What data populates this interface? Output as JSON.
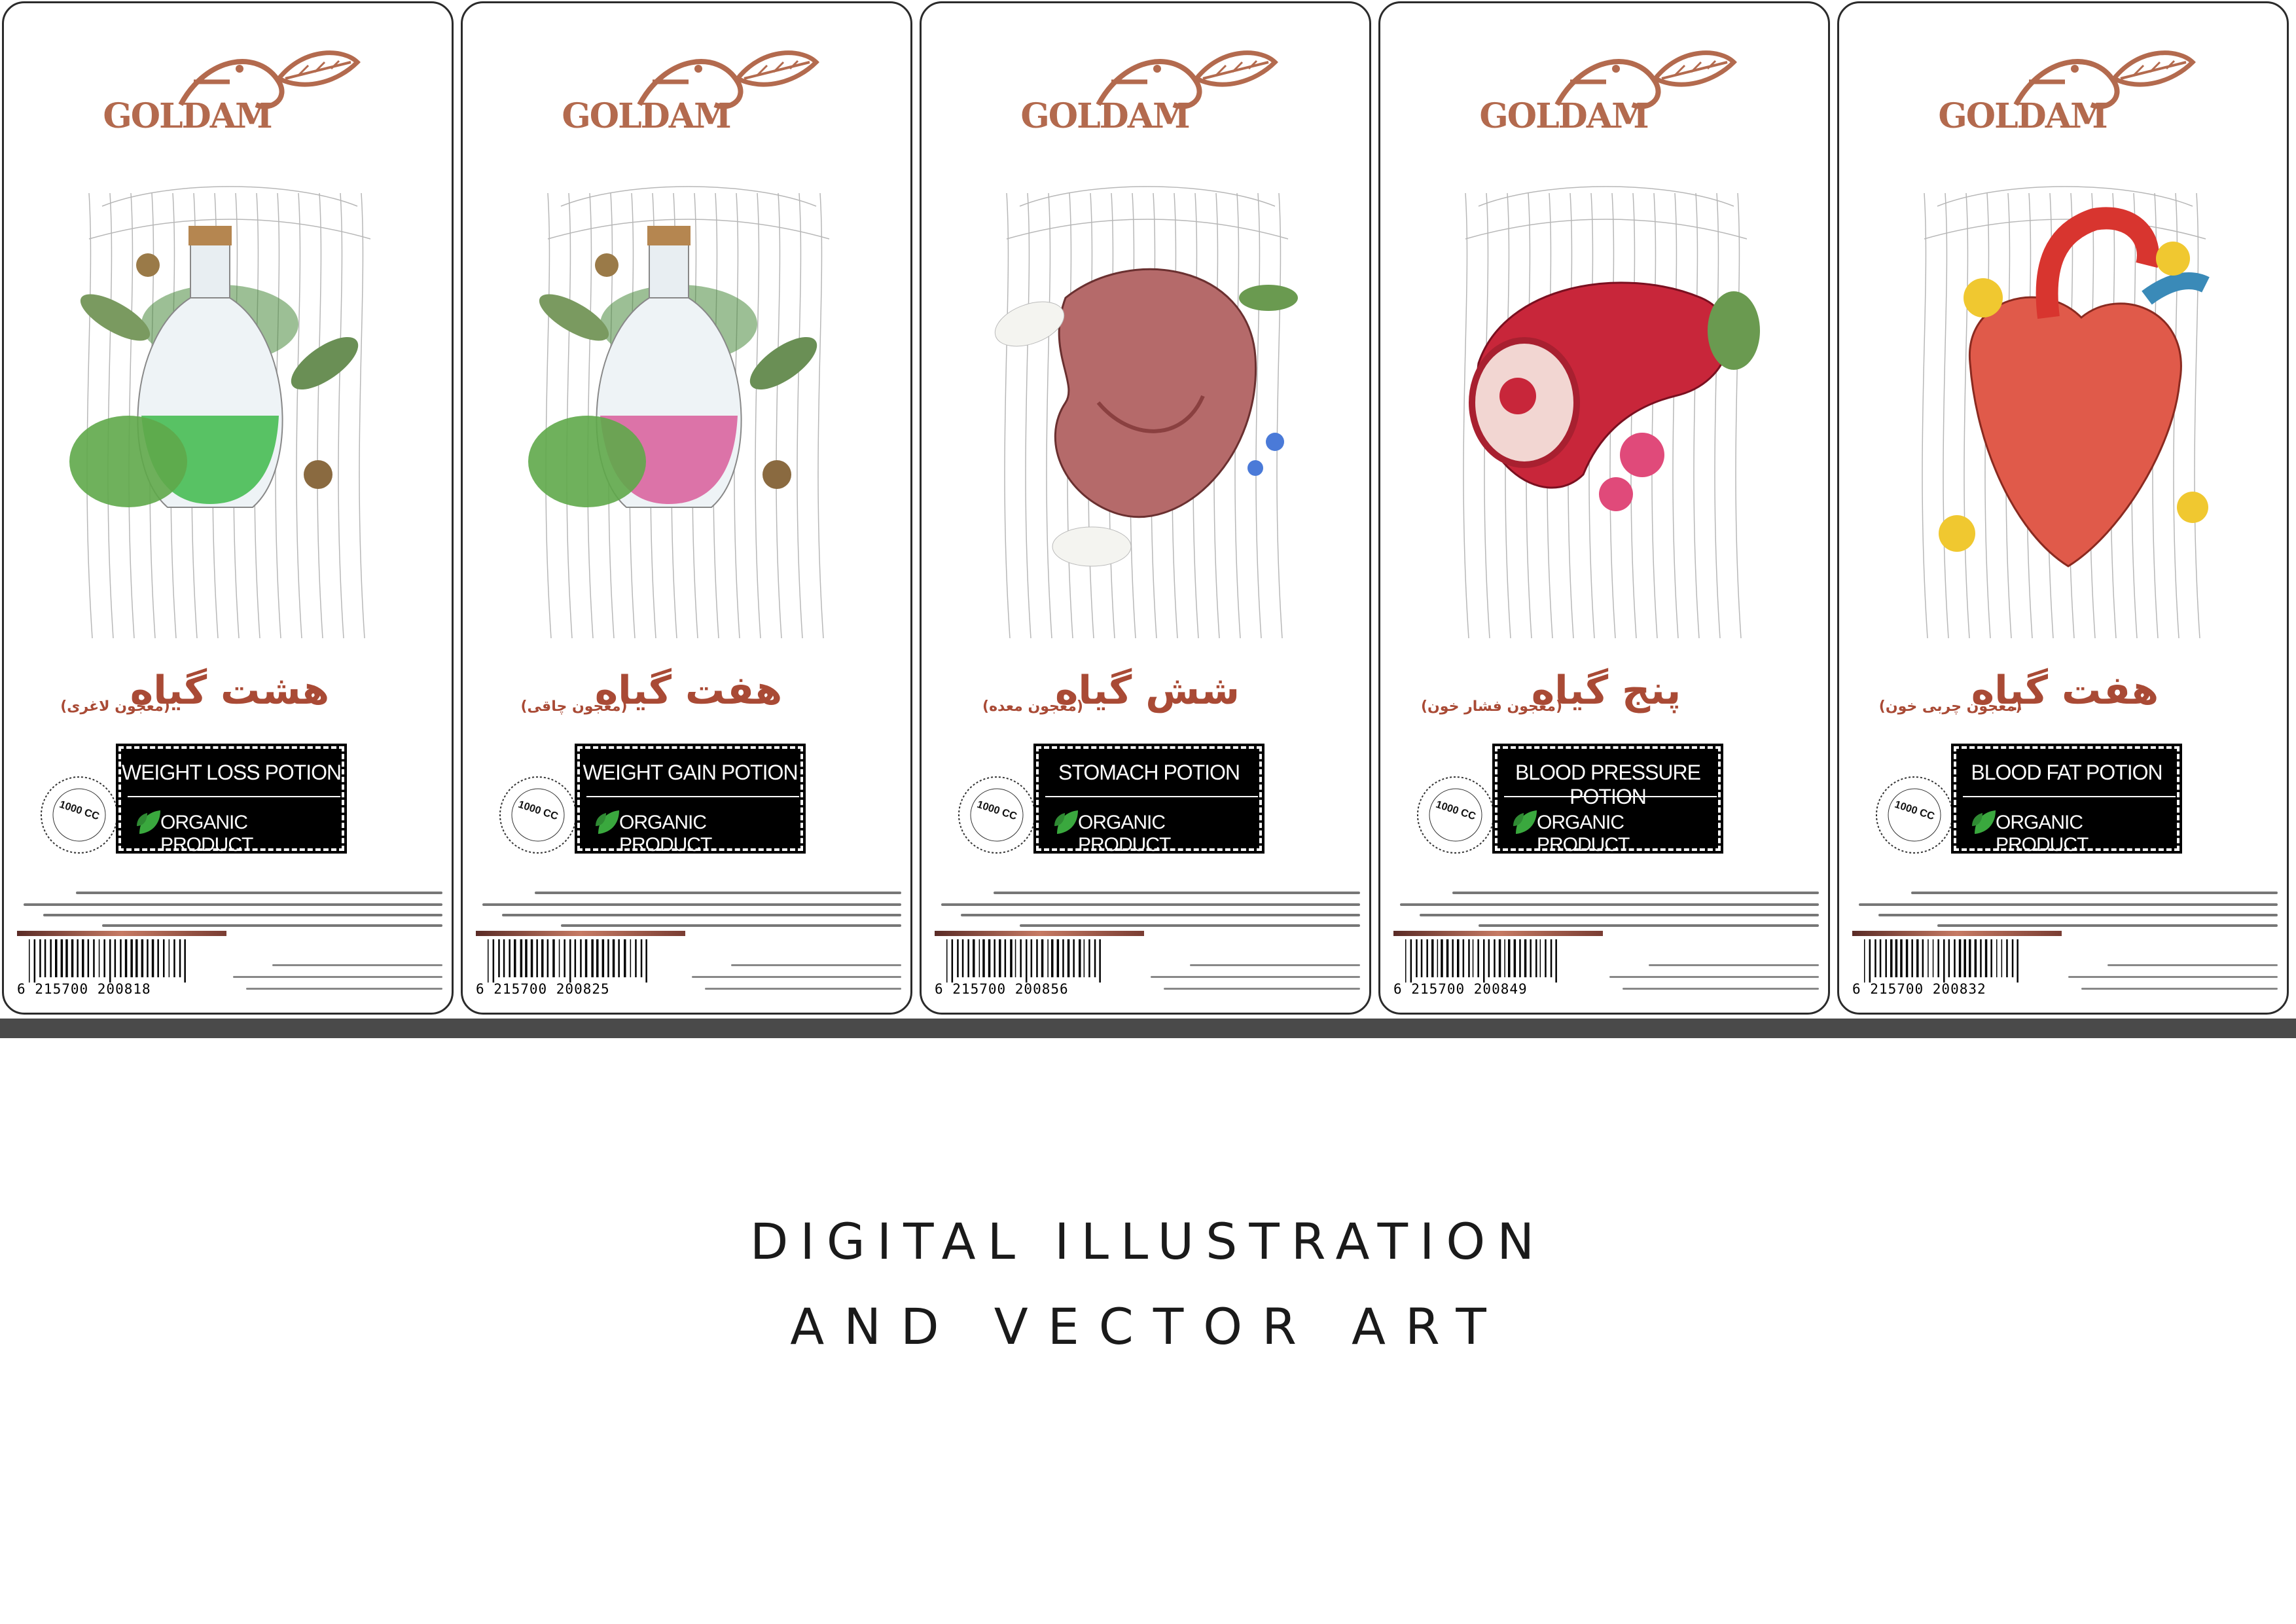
{
  "brand": {
    "logo_text": "GOLDAM",
    "accent_color": "#b36a4e",
    "title_color": "#a94a35"
  },
  "labels": [
    {
      "title_fa": "هشت گیاه",
      "subtitle_fa": "(معجون لاغری)",
      "potion_name": "WEIGHT LOSS POTION",
      "organic": "ORGANIC PRODUCT",
      "volume": "1000 CC",
      "barcode": "6 215700 200818",
      "illustration_icon": "potion-bottle-green-icon",
      "art_color": "#3db84a"
    },
    {
      "title_fa": "هفت گیاه",
      "subtitle_fa": "(معجون چاقی)",
      "potion_name": "WEIGHT GAIN POTION",
      "organic": "ORGANIC PRODUCT",
      "volume": "1000 CC",
      "barcode": "6 215700 200825",
      "illustration_icon": "potion-bottle-pink-icon",
      "art_color": "#d85c9a"
    },
    {
      "title_fa": "شش گیاه",
      "subtitle_fa": "(معجون معده)",
      "potion_name": "STOMACH POTION",
      "organic": "ORGANIC PRODUCT",
      "volume": "1000 CC",
      "barcode": "6 215700 200856",
      "illustration_icon": "stomach-icon",
      "art_color": "#b56a6a"
    },
    {
      "title_fa": "پنج گیاه",
      "subtitle_fa": "(معجون فشار خون)",
      "potion_name": "BLOOD PRESSURE POTION",
      "organic": "ORGANIC PRODUCT",
      "volume": "1000 CC",
      "barcode": "6 215700 200849",
      "illustration_icon": "blood-vessel-icon",
      "art_color": "#c8263a"
    },
    {
      "title_fa": "هفت گیاه",
      "subtitle_fa": "(معجون چربی خون)",
      "potion_name": "BLOOD FAT POTION",
      "organic": "ORGANIC PRODUCT",
      "volume": "1000 CC",
      "barcode": "6 215700 200832",
      "illustration_icon": "heart-icon",
      "art_color": "#e05a4a"
    }
  ],
  "footer": {
    "line1": "DIGITAL ILLUSTRATION",
    "line2": "AND VECTOR ART"
  }
}
